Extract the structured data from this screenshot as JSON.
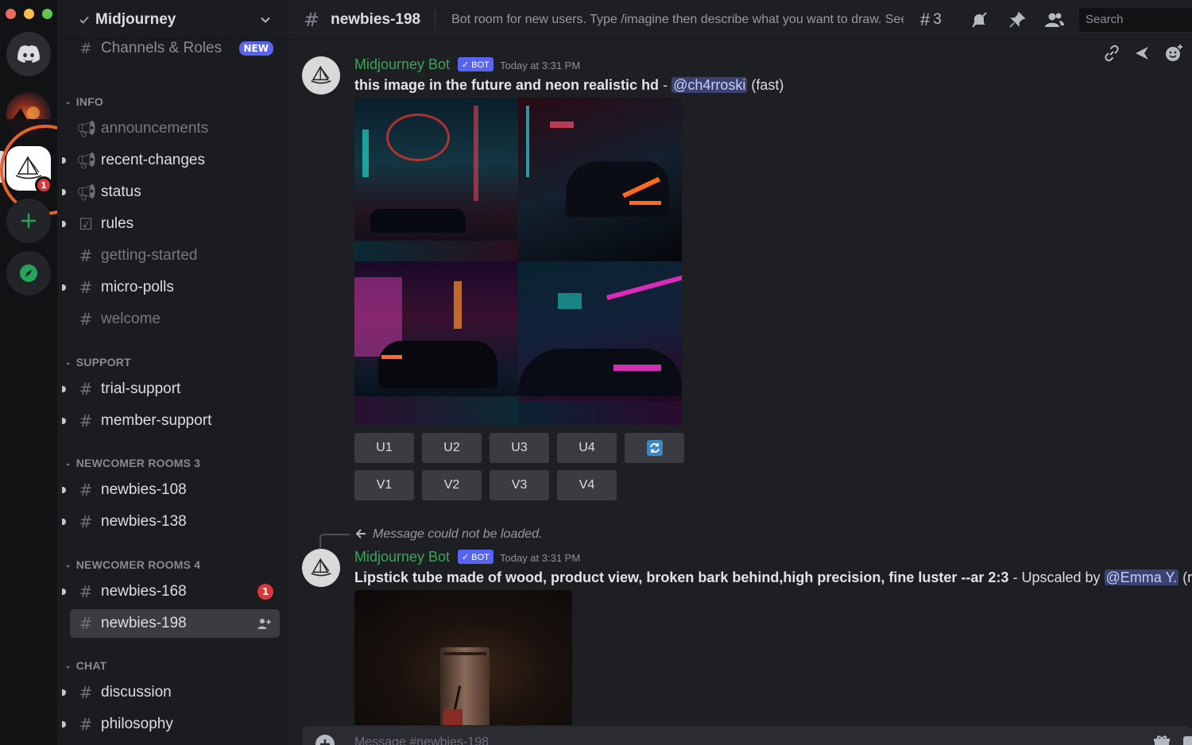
{
  "rail": {
    "notification_count": "1"
  },
  "sidebar": {
    "server_name": "Midjourney",
    "channels_roles": {
      "label": "Channels & Roles",
      "badge": "NEW"
    },
    "categories": [
      {
        "name": "INFO"
      },
      {
        "name": "SUPPORT"
      },
      {
        "name": "NEWCOMER ROOMS 3"
      },
      {
        "name": "NEWCOMER ROOMS 4"
      },
      {
        "name": "CHAT"
      }
    ],
    "channels": [
      {
        "label": "announcements"
      },
      {
        "label": "recent-changes"
      },
      {
        "label": "status"
      },
      {
        "label": "rules"
      },
      {
        "label": "getting-started"
      },
      {
        "label": "micro-polls"
      },
      {
        "label": "welcome"
      },
      {
        "label": "trial-support"
      },
      {
        "label": "member-support"
      },
      {
        "label": "newbies-108"
      },
      {
        "label": "newbies-138"
      },
      {
        "label": "newbies-168",
        "badge": "1"
      },
      {
        "label": "newbies-198"
      },
      {
        "label": "discussion"
      },
      {
        "label": "philosophy"
      }
    ]
  },
  "topbar": {
    "channel": "newbies-198",
    "topic": "Bot room for new users. Type /imagine then describe what you want to draw. See ...",
    "threads_count": "3",
    "search_placeholder": "Search"
  },
  "messages": [
    {
      "author": "Midjourney Bot",
      "badge": "✓ BOT",
      "timestamp": "Today at 3:31 PM",
      "prompt": "this image in the future and neon realistic hd",
      "separator": " - ",
      "mention": "@ch4rroski",
      "suffix": " (fast)",
      "upscale_buttons": [
        "U1",
        "U2",
        "U3",
        "U4"
      ],
      "variation_buttons": [
        "V1",
        "V2",
        "V3",
        "V4"
      ]
    },
    {
      "reply_text": "Message could not be loaded.",
      "author": "Midjourney Bot",
      "badge": "✓ BOT",
      "timestamp": "Today at 3:31 PM",
      "prompt": "Lipstick tube made of wood, product view, broken bark behind,high precision, fine luster --ar 2:3",
      "separator": " - Upscaled by ",
      "mention": "@Emma Y.",
      "suffix": " (rela"
    }
  ],
  "composer": {
    "placeholder": "Message #newbies-198"
  },
  "colors": {
    "accent": "#5865f2",
    "bot_name": "#3ba55c",
    "highlight_ring": "#e8612c",
    "unread_badge": "#da373c"
  }
}
